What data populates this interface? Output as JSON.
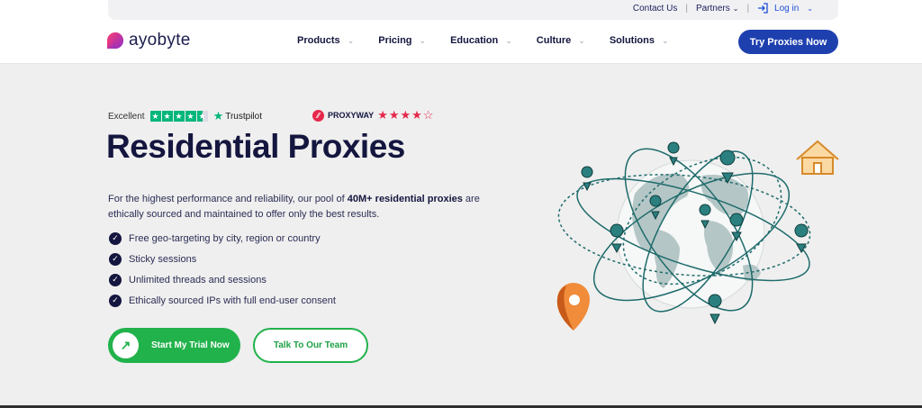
{
  "topbar": {
    "contact": "Contact Us",
    "partners": "Partners",
    "login": "Log in"
  },
  "brand": {
    "name": "ayobyte"
  },
  "nav": {
    "items": [
      {
        "label": "Products"
      },
      {
        "label": "Pricing"
      },
      {
        "label": "Education"
      },
      {
        "label": "Culture"
      },
      {
        "label": "Solutions"
      }
    ],
    "cta": "Try Proxies Now"
  },
  "rating": {
    "excellent": "Excellent",
    "trustpilot": "Trustpilot",
    "proxyway": "PROXYWAY",
    "proxyway_stars": "★★★★☆"
  },
  "hero": {
    "title": "Residential Proxies",
    "desc_before": "For the highest performance and reliability, our pool of ",
    "desc_bold": "40M+ residential proxies",
    "desc_after": " are ethically sourced and maintained to offer only the best results.",
    "features": [
      "Free geo-targeting by city, region or country",
      "Sticky sessions",
      "Unlimited threads and sessions",
      "Ethically sourced IPs with full end-user consent"
    ],
    "primary_button": "Start My Trial Now",
    "secondary_button": "Talk To Our Team"
  },
  "colors": {
    "brand_blue": "#1e40af",
    "green": "#22b24c",
    "navy": "#14163f",
    "trustpilot_green": "#00b67a",
    "proxyway_red": "#e5284a"
  }
}
